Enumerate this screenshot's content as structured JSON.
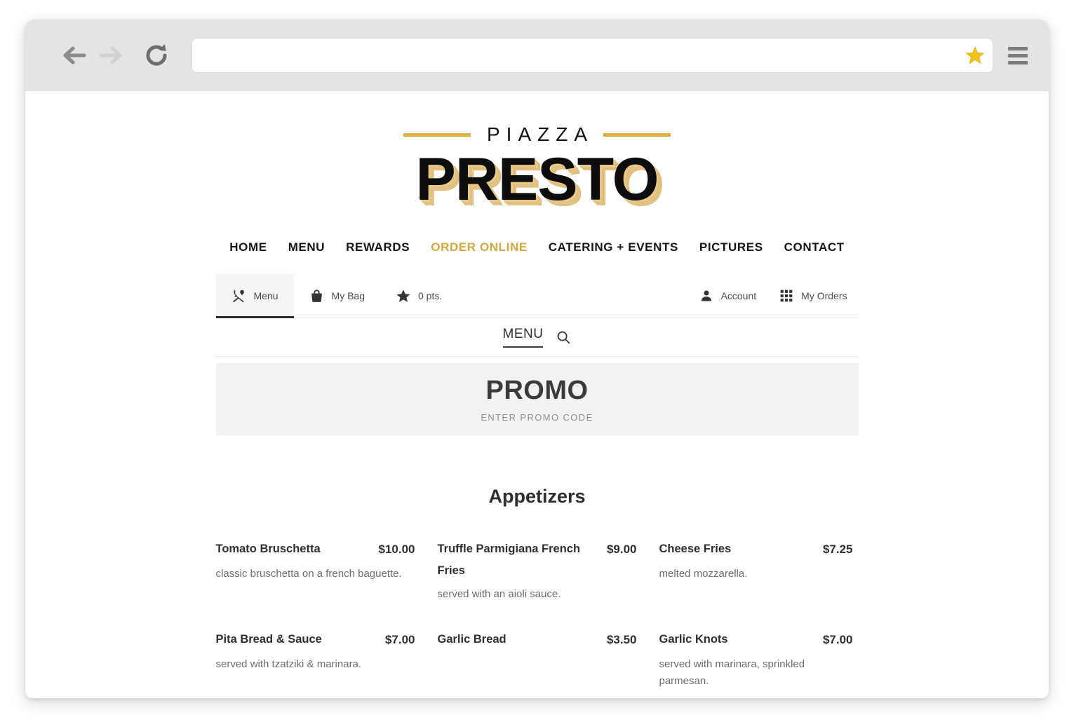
{
  "browser": {
    "back_icon": "back-arrow-icon",
    "forward_icon": "forward-arrow-icon",
    "reload_icon": "reload-icon",
    "url_value": "",
    "url_placeholder": "",
    "bookmark_icon": "star-icon",
    "menu_icon": "hamburger-menu-icon"
  },
  "site": {
    "logo_top": "PIAZZA",
    "logo_main": "PRESTO",
    "accent_gold": "#d3a93f",
    "logo_rule_gold": "#e0b040"
  },
  "nav": {
    "items": [
      {
        "label": "HOME",
        "active": false
      },
      {
        "label": "MENU",
        "active": false
      },
      {
        "label": "REWARDS",
        "active": false
      },
      {
        "label": "ORDER ONLINE",
        "active": true
      },
      {
        "label": "CATERING + EVENTS",
        "active": false
      },
      {
        "label": "PICTURES",
        "active": false
      },
      {
        "label": "CONTACT",
        "active": false
      }
    ]
  },
  "widget": {
    "left_tabs": [
      {
        "label": "Menu",
        "icon": "fork-and-spoon-icon",
        "active": true
      },
      {
        "label": "My Bag",
        "icon": "shopping-bag-icon",
        "active": false
      },
      {
        "label": "0 pts.",
        "icon": "star-icon",
        "active": false
      }
    ],
    "right_tabs": [
      {
        "label": "Account",
        "icon": "person-icon"
      },
      {
        "label": "My Orders",
        "icon": "grid-icon"
      }
    ],
    "menu_bar": {
      "label": "MENU",
      "search_icon": "search-icon"
    },
    "promo": {
      "title": "PROMO",
      "subtitle": "ENTER PROMO CODE"
    }
  },
  "menu": {
    "section_title": "Appetizers",
    "items": [
      {
        "name": "Tomato Bruschetta",
        "price": "$10.00",
        "desc": "classic bruschetta on a french baguette."
      },
      {
        "name": "Truffle Parmigiana French Fries",
        "price": "$9.00",
        "desc": "served with an aioli sauce."
      },
      {
        "name": "Cheese Fries",
        "price": "$7.25",
        "desc": "melted mozzarella."
      },
      {
        "name": "Pita Bread & Sauce",
        "price": "$7.00",
        "desc": "served with tzatziki & marinara."
      },
      {
        "name": "Garlic Bread",
        "price": "$3.50",
        "desc": ""
      },
      {
        "name": "Garlic Knots",
        "price": "$7.00",
        "desc": "served with marinara, sprinkled parmesan."
      }
    ]
  }
}
